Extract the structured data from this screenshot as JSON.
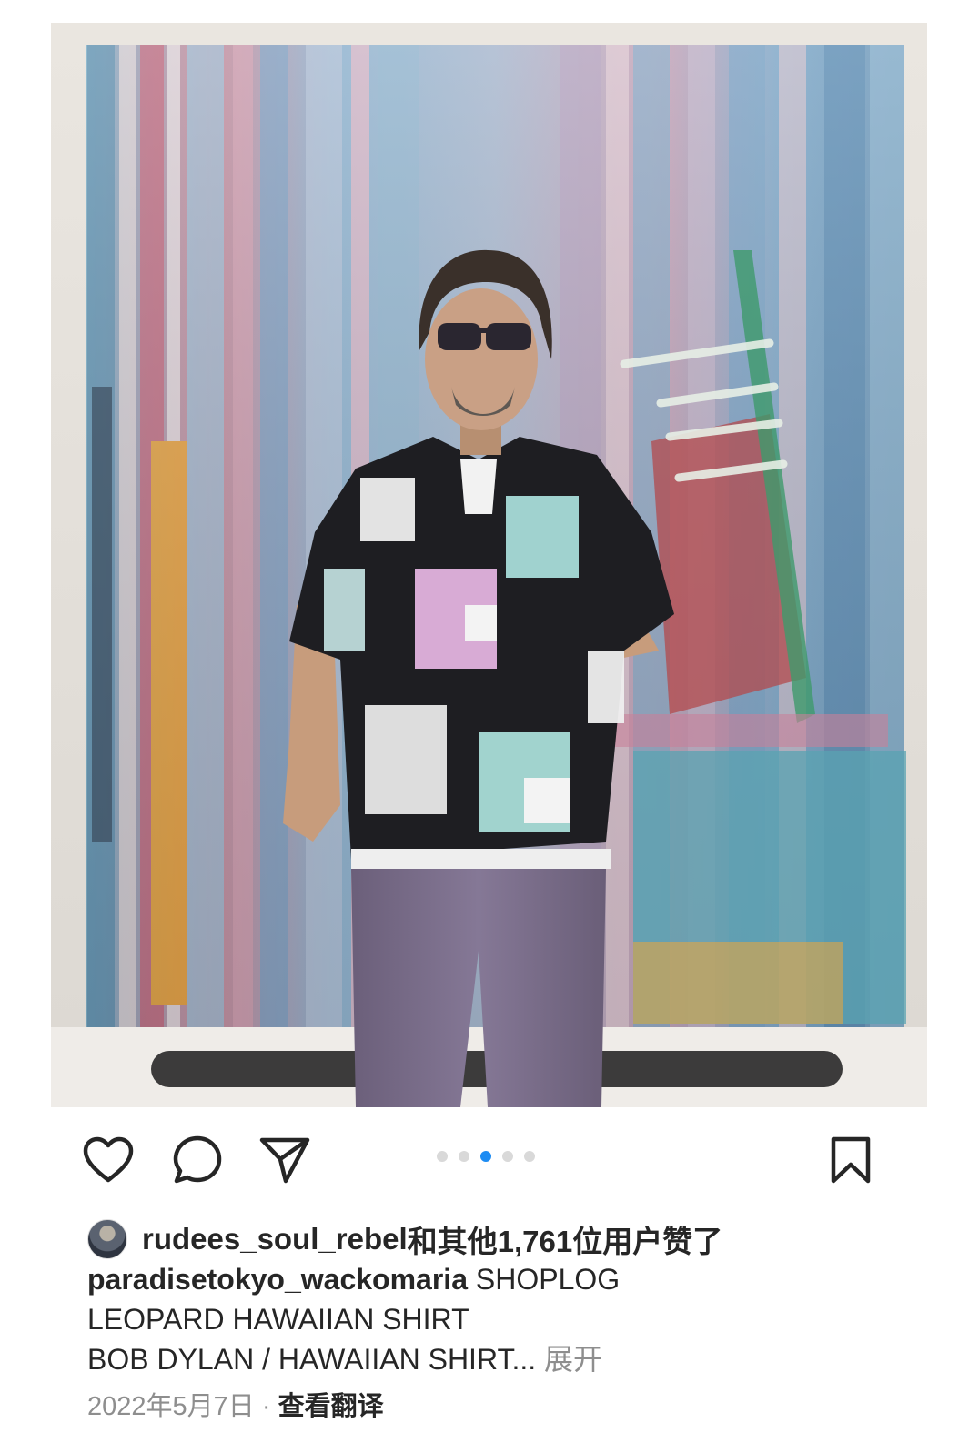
{
  "post": {
    "liked_by_user": "rudees_soul_rebel",
    "liked_suffix": "和其他1,761位用户赞了",
    "caption_owner": "paradisetokyo_wackomaria",
    "caption_line1": " SHOPLOG",
    "caption_line2": "LEOPARD HAWAIIAN SHIRT",
    "caption_line3": "BOB DYLAN / HAWAIIAN SHIRT...",
    "expand_label": " 展开",
    "date": "2022年5月7日",
    "separator": " · ",
    "translate_label": "查看翻译",
    "carousel": {
      "count": 5,
      "active_index": 2
    }
  },
  "icons": {
    "like": "heart-icon",
    "comment": "comment-bubble-icon",
    "share": "send-plane-icon",
    "save": "bookmark-icon"
  },
  "colors": {
    "accent": "#1d8cf3",
    "text": "#262626",
    "muted": "#8e8e8e",
    "dot_inactive": "#d9d9d9"
  }
}
